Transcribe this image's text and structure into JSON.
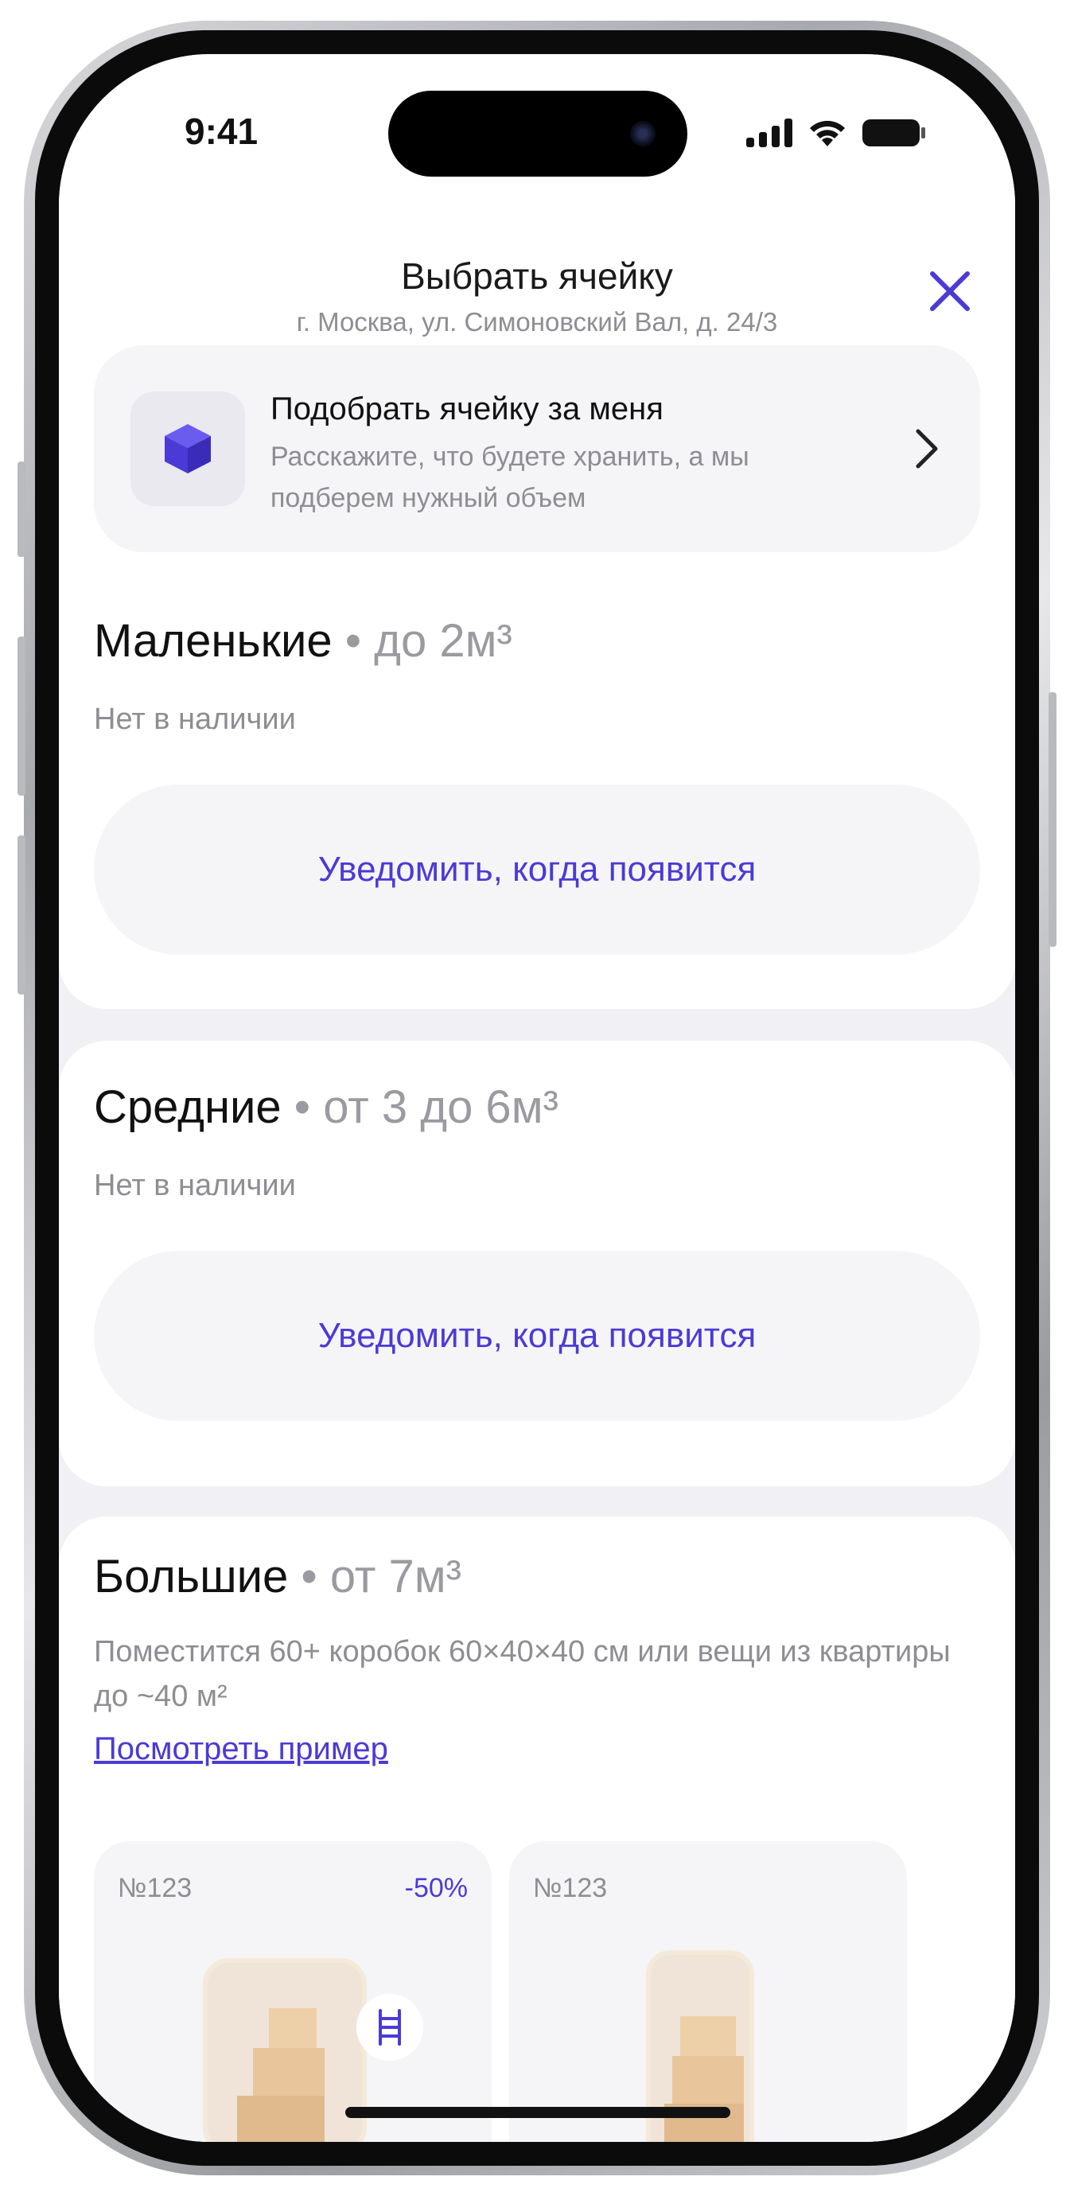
{
  "status_bar": {
    "time": "9:41"
  },
  "header": {
    "title": "Выбрать ячейку",
    "subtitle": "г. Москва, ул. Симоновский Вал, д. 24/3"
  },
  "pick_card": {
    "title": "Подобрать ячейку за меня",
    "description": "Расскажите, что будете хранить, а мы подберем нужный объем"
  },
  "categories": [
    {
      "name": "Маленькие",
      "range": " • до 2м³",
      "status": "Нет в наличии",
      "button": "Уведомить, когда появится"
    },
    {
      "name": "Средние",
      "range": " • от 3 до 6м³",
      "status": "Нет в наличии",
      "button": "Уведомить, когда появится"
    },
    {
      "name": "Большие",
      "range": " • от 7м³",
      "description": "Поместится 60+ коробок 60×40×40 см или вещи из квартиры до ~40 м²",
      "link": "Посмотреть пример"
    }
  ],
  "cells": [
    {
      "number": "№123",
      "discount": "-50%",
      "icon": "ladder-icon"
    },
    {
      "number": "№123",
      "discount": ""
    }
  ],
  "colors": {
    "accent": "#4b3ad6",
    "muted_text": "#8d8d93",
    "card_bg": "#f5f5f8"
  }
}
